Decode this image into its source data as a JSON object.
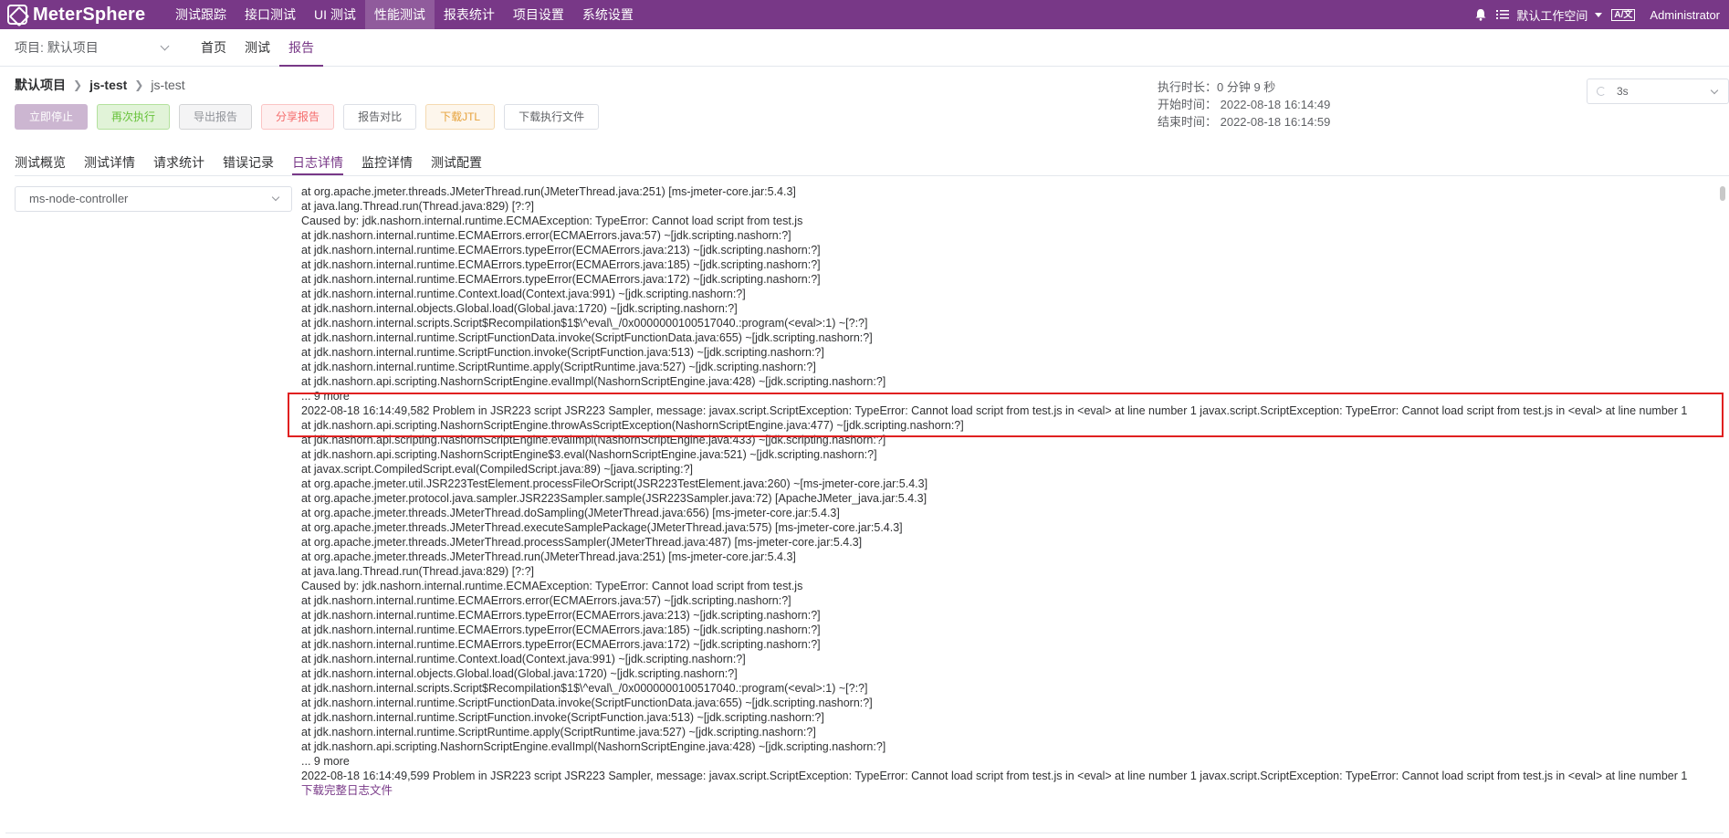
{
  "brand": {
    "name": "MeterSphere"
  },
  "topnav": {
    "items": [
      "测试跟踪",
      "接口测试",
      "UI 测试",
      "性能测试",
      "报表统计",
      "项目设置",
      "系统设置"
    ],
    "active_index": 3,
    "workspace": "默认工作空间",
    "lang_badge": "A/文",
    "user": "Administrator"
  },
  "project_bar": {
    "project_label": "项目: 默认项目",
    "items": [
      "首页",
      "测试",
      "报告"
    ],
    "active_index": 2
  },
  "breadcrumb": {
    "project": "默认项目",
    "test": "js-test",
    "report": "js-test"
  },
  "actions": {
    "stop": "立即停止",
    "rerun": "再次执行",
    "export": "导出报告",
    "share": "分享报告",
    "compare": "报告对比",
    "download_jtl": "下载JTL",
    "download_files": "下载执行文件"
  },
  "run_info": {
    "duration": "执行时长：0 分钟 9 秒",
    "start": "开始时间：  2022-08-18 16:14:49",
    "end": "结束时间：  2022-08-18 16:14:59"
  },
  "refresh": {
    "value": "3s"
  },
  "tabs": {
    "items": [
      "测试概览",
      "测试详情",
      "请求统计",
      "错误记录",
      "日志详情",
      "监控详情",
      "测试配置"
    ],
    "active_index": 4
  },
  "node_select": {
    "value": "ms-node-controller"
  },
  "log": {
    "lines": [
      "at org.apache.jmeter.threads.JMeterThread.run(JMeterThread.java:251) [ms-jmeter-core.jar:5.4.3]",
      "at java.lang.Thread.run(Thread.java:829) [?:?]",
      "Caused by: jdk.nashorn.internal.runtime.ECMAException: TypeError: Cannot load script from test.js",
      "at jdk.nashorn.internal.runtime.ECMAErrors.error(ECMAErrors.java:57) ~[jdk.scripting.nashorn:?]",
      "at jdk.nashorn.internal.runtime.ECMAErrors.typeError(ECMAErrors.java:213) ~[jdk.scripting.nashorn:?]",
      "at jdk.nashorn.internal.runtime.ECMAErrors.typeError(ECMAErrors.java:185) ~[jdk.scripting.nashorn:?]",
      "at jdk.nashorn.internal.runtime.ECMAErrors.typeError(ECMAErrors.java:172) ~[jdk.scripting.nashorn:?]",
      "at jdk.nashorn.internal.runtime.Context.load(Context.java:991) ~[jdk.scripting.nashorn:?]",
      "at jdk.nashorn.internal.objects.Global.load(Global.java:1720) ~[jdk.scripting.nashorn:?]",
      "at jdk.nashorn.internal.scripts.Script$Recompilation$1$\\^eval\\_/0x0000000100517040.:program(<eval>:1) ~[?:?]",
      "at jdk.nashorn.internal.runtime.ScriptFunctionData.invoke(ScriptFunctionData.java:655) ~[jdk.scripting.nashorn:?]",
      "at jdk.nashorn.internal.runtime.ScriptFunction.invoke(ScriptFunction.java:513) ~[jdk.scripting.nashorn:?]",
      "at jdk.nashorn.internal.runtime.ScriptRuntime.apply(ScriptRuntime.java:527) ~[jdk.scripting.nashorn:?]",
      "at jdk.nashorn.api.scripting.NashornScriptEngine.evalImpl(NashornScriptEngine.java:428) ~[jdk.scripting.nashorn:?]",
      "... 9 more",
      "2022-08-18 16:14:49,582 Problem in JSR223 script JSR223 Sampler, message: javax.script.ScriptException: TypeError: Cannot load script from test.js in <eval> at line number 1 javax.script.ScriptException: TypeError: Cannot load script from test.js in <eval> at line number 1",
      "at jdk.nashorn.api.scripting.NashornScriptEngine.throwAsScriptException(NashornScriptEngine.java:477) ~[jdk.scripting.nashorn:?]",
      "at jdk.nashorn.api.scripting.NashornScriptEngine.evalImpl(NashornScriptEngine.java:433) ~[jdk.scripting.nashorn:?]",
      "at jdk.nashorn.api.scripting.NashornScriptEngine$3.eval(NashornScriptEngine.java:521) ~[jdk.scripting.nashorn:?]",
      "at javax.script.CompiledScript.eval(CompiledScript.java:89) ~[java.scripting:?]",
      "at org.apache.jmeter.util.JSR223TestElement.processFileOrScript(JSR223TestElement.java:260) ~[ms-jmeter-core.jar:5.4.3]",
      "at org.apache.jmeter.protocol.java.sampler.JSR223Sampler.sample(JSR223Sampler.java:72) [ApacheJMeter_java.jar:5.4.3]",
      "at org.apache.jmeter.threads.JMeterThread.doSampling(JMeterThread.java:656) [ms-jmeter-core.jar:5.4.3]",
      "at org.apache.jmeter.threads.JMeterThread.executeSamplePackage(JMeterThread.java:575) [ms-jmeter-core.jar:5.4.3]",
      "at org.apache.jmeter.threads.JMeterThread.processSampler(JMeterThread.java:487) [ms-jmeter-core.jar:5.4.3]",
      "at org.apache.jmeter.threads.JMeterThread.run(JMeterThread.java:251) [ms-jmeter-core.jar:5.4.3]",
      "at java.lang.Thread.run(Thread.java:829) [?:?]",
      "Caused by: jdk.nashorn.internal.runtime.ECMAException: TypeError: Cannot load script from test.js",
      "at jdk.nashorn.internal.runtime.ECMAErrors.error(ECMAErrors.java:57) ~[jdk.scripting.nashorn:?]",
      "at jdk.nashorn.internal.runtime.ECMAErrors.typeError(ECMAErrors.java:213) ~[jdk.scripting.nashorn:?]",
      "at jdk.nashorn.internal.runtime.ECMAErrors.typeError(ECMAErrors.java:185) ~[jdk.scripting.nashorn:?]",
      "at jdk.nashorn.internal.runtime.ECMAErrors.typeError(ECMAErrors.java:172) ~[jdk.scripting.nashorn:?]",
      "at jdk.nashorn.internal.runtime.Context.load(Context.java:991) ~[jdk.scripting.nashorn:?]",
      "at jdk.nashorn.internal.objects.Global.load(Global.java:1720) ~[jdk.scripting.nashorn:?]",
      "at jdk.nashorn.internal.scripts.Script$Recompilation$1$\\^eval\\_/0x0000000100517040.:program(<eval>:1) ~[?:?]",
      "at jdk.nashorn.internal.runtime.ScriptFunctionData.invoke(ScriptFunctionData.java:655) ~[jdk.scripting.nashorn:?]",
      "at jdk.nashorn.internal.runtime.ScriptFunction.invoke(ScriptFunction.java:513) ~[jdk.scripting.nashorn:?]",
      "at jdk.nashorn.internal.runtime.ScriptRuntime.apply(ScriptRuntime.java:527) ~[jdk.scripting.nashorn:?]",
      "at jdk.nashorn.api.scripting.NashornScriptEngine.evalImpl(NashornScriptEngine.java:428) ~[jdk.scripting.nashorn:?]",
      "... 9 more",
      "2022-08-18 16:14:49,599 Problem in JSR223 script JSR223 Sampler, message: javax.script.ScriptException: TypeError: Cannot load script from test.js in <eval> at line number 1 javax.script.ScriptException: TypeError: Cannot load script from test.js in <eval> at line number 1"
    ],
    "download_link": "下载完整日志文件"
  },
  "colors": {
    "brand": "#783887",
    "highlight_border": "#e02020"
  }
}
